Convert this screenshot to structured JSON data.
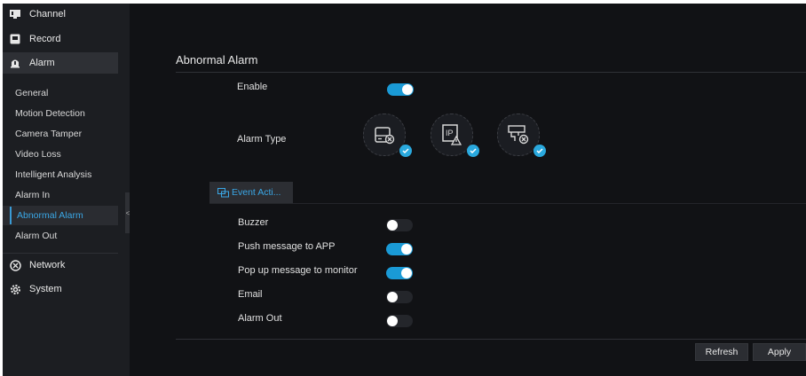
{
  "sidebar": {
    "top_items": [
      {
        "label": "Channel",
        "icon": "monitor-icon"
      },
      {
        "label": "Record",
        "icon": "record-icon"
      },
      {
        "label": "Alarm",
        "icon": "alarm-icon"
      }
    ],
    "alarm_subitems": [
      {
        "label": "General"
      },
      {
        "label": "Motion Detection"
      },
      {
        "label": "Camera Tamper"
      },
      {
        "label": "Video Loss"
      },
      {
        "label": "Intelligent Analysis"
      },
      {
        "label": "Alarm In"
      },
      {
        "label": "Abnormal Alarm"
      },
      {
        "label": "Alarm Out"
      }
    ],
    "bottom_items": [
      {
        "label": "Network",
        "icon": "network-icon"
      },
      {
        "label": "System",
        "icon": "gear-icon"
      }
    ],
    "active_item": "Abnormal Alarm",
    "collapse_glyph": "<"
  },
  "main": {
    "title": "Abnormal Alarm",
    "enable": {
      "label": "Enable",
      "on": true
    },
    "alarm_type": {
      "label": "Alarm Type",
      "options": [
        {
          "icon": "disk-error-icon",
          "selected": true
        },
        {
          "icon": "ip-conflict-icon",
          "ip_text": "IP",
          "selected": true
        },
        {
          "icon": "network-disconnect-icon",
          "selected": true
        }
      ]
    },
    "tab": {
      "label": "Event Acti...",
      "icon": "event-action-icon"
    },
    "event_actions": [
      {
        "label": "Buzzer",
        "on": false
      },
      {
        "label": "Push message to APP",
        "on": true
      },
      {
        "label": "Pop up message to monitor",
        "on": true
      },
      {
        "label": "Email",
        "on": false
      },
      {
        "label": "Alarm Out",
        "on": false
      }
    ],
    "buttons": {
      "refresh": "Refresh",
      "apply": "Apply"
    }
  },
  "colors": {
    "accent": "#1a9ad6",
    "active_text": "#3aa7e6",
    "background": "#111215",
    "sidebar": "#1c1e22"
  }
}
